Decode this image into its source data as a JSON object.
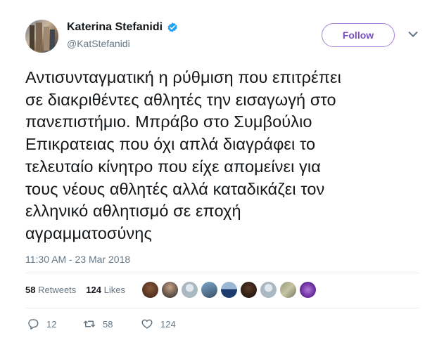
{
  "user": {
    "display_name": "Katerina Stefanidi",
    "handle": "@KatStefanidi",
    "verified_icon": "verified-badge-icon",
    "avatar_icon": "profile-photo"
  },
  "follow_label": "Follow",
  "tweet": {
    "text": "Αντισυνταγματική η ρύθμιση που επιτρέπει\nσε διακριθέντες αθλητές την εισαγωγή στο\nπανεπιστήμιο. Μπράβο στο Συμβούλιο\nΕπικρατειας που όχι απλά διαγράφει το\nτελευταίο κίνητρο που είχε απομείνει για\nτους νέους αθλητές αλλά καταδικάζει τον\nελληνικό αθλητισμό σε εποχή\nαγραμματοσύνης",
    "timestamp": "11:30 AM - 23 Mar 2018"
  },
  "stats": {
    "retweets_count": "58",
    "retweets_label": "Retweets",
    "likes_count": "124",
    "likes_label": "Likes"
  },
  "actions": {
    "reply_count": "12",
    "retweet_count": "58",
    "like_count": "124"
  },
  "colors": {
    "accent": "#7a4fc4",
    "follow_border": "#a580d6",
    "verified": "#1da1f2",
    "muted_text": "#657786"
  }
}
